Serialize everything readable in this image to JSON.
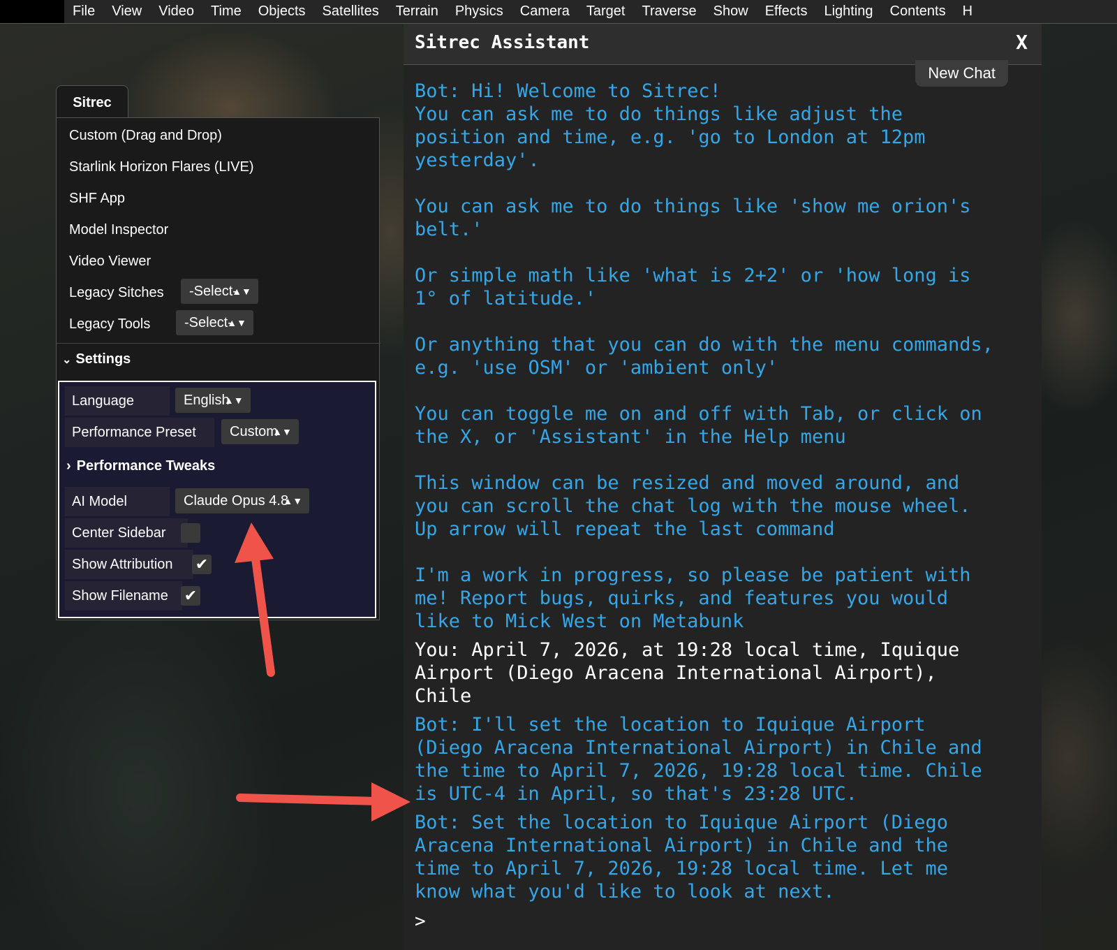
{
  "menubar": {
    "items": [
      "File",
      "View",
      "Video",
      "Time",
      "Objects",
      "Satellites",
      "Terrain",
      "Physics",
      "Camera",
      "Target",
      "Traverse",
      "Show",
      "Effects",
      "Lighting",
      "Contents",
      "H"
    ]
  },
  "sidebar": {
    "tab_label": "Sitrec",
    "items": [
      "Custom (Drag and Drop)",
      "Starlink Horizon Flares (LIVE)",
      "SHF App",
      "Model Inspector",
      "Video Viewer"
    ],
    "legacy_sitches": {
      "label": "Legacy Sitches",
      "value": "-Select-"
    },
    "legacy_tools": {
      "label": "Legacy Tools",
      "value": "-Select-"
    },
    "settings": {
      "heading": "Settings",
      "language": {
        "label": "Language",
        "value": "English"
      },
      "performance_preset": {
        "label": "Performance Preset",
        "value": "Custom"
      },
      "performance_tweaks": "Performance Tweaks",
      "ai_model": {
        "label": "AI Model",
        "value": "Claude Opus 4.8"
      },
      "center_sidebar": {
        "label": "Center Sidebar",
        "checked": false
      },
      "show_attribution": {
        "label": "Show Attribution",
        "checked": true
      },
      "show_filename": {
        "label": "Show Filename",
        "checked": true
      }
    }
  },
  "assistant": {
    "title": "Sitrec Assistant",
    "close_label": "X",
    "new_chat_label": "New Chat",
    "messages": [
      {
        "role": "bot",
        "text": "Bot: Hi! Welcome to Sitrec!\nYou can ask me to do things like adjust the\nposition and time, e.g. 'go to London at 12pm\nyesterday'.\n\nYou can ask me to do things like 'show me orion's\nbelt.'\n\nOr simple math like 'what is 2+2' or 'how long is\n1° of latitude.'\n\nOr anything that you can do with the menu commands,\ne.g. 'use OSM' or 'ambient only'\n\nYou can toggle me on and off with Tab, or click on\nthe X, or 'Assistant' in the Help menu\n\nThis window can be resized and moved around, and\nyou can scroll the chat log with the mouse wheel.\nUp arrow will repeat the last command\n\nI'm a work in progress, so please be patient with\nme! Report bugs, quirks, and features you would\nlike to Mick West on Metabunk"
      },
      {
        "role": "you",
        "text": "You: April 7, 2026, at 19:28 local time, Iquique\nAirport (Diego Aracena International Airport),\nChile"
      },
      {
        "role": "bot",
        "text": "Bot: I'll set the location to Iquique Airport\n(Diego Aracena International Airport) in Chile and\nthe time to April 7, 2026, 19:28 local time. Chile\nis UTC-4 in April, so that's 23:28 UTC."
      },
      {
        "role": "bot",
        "text": "Bot: Set the location to Iquique Airport (Diego\nAracena International Airport) in Chile and the\ntime to April 7, 2026, 19:28 local time. Let me\nknow what you'd like to look at next."
      }
    ],
    "prompt": ">"
  },
  "colors": {
    "bot_text": "#36a6e6",
    "you_text": "#ffffff",
    "arrow": "#f0534a"
  }
}
